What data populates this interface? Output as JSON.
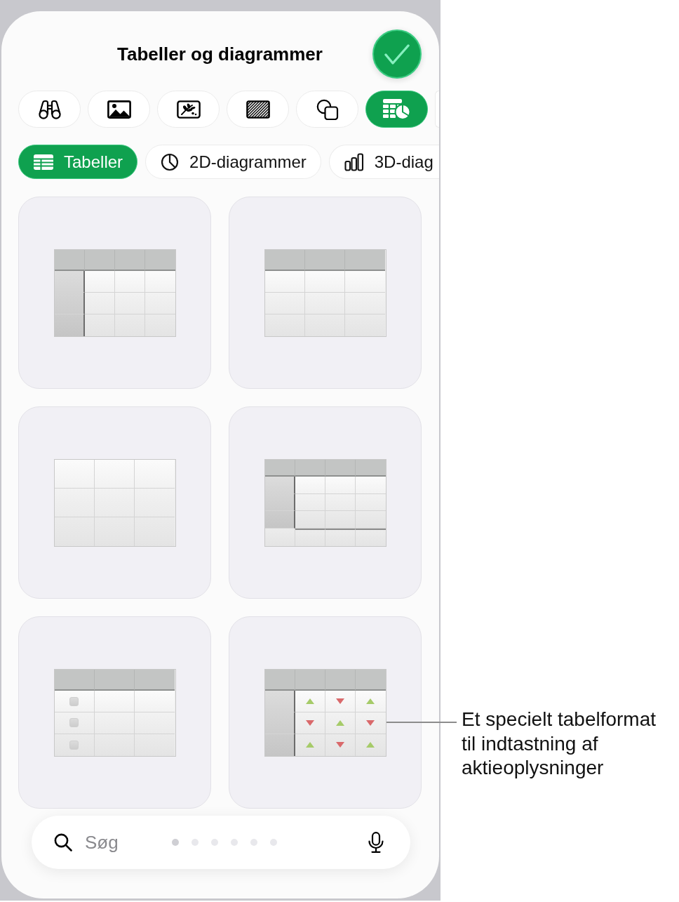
{
  "title": "Tabeller og diagrammer",
  "categories": [
    {
      "selected": false
    },
    {
      "selected": false
    },
    {
      "selected": false
    },
    {
      "selected": false
    },
    {
      "selected": false
    },
    {
      "selected": true
    },
    {
      "selected": false
    }
  ],
  "segments": [
    {
      "label": "Tabeller",
      "selected": true
    },
    {
      "label": "2D-diagrammer",
      "selected": false
    },
    {
      "label": "3D-diag",
      "selected": false
    }
  ],
  "table_styles": [
    {
      "kind": "headers"
    },
    {
      "kind": "header-row"
    },
    {
      "kind": "plain"
    },
    {
      "kind": "headers-footer"
    },
    {
      "kind": "checklist"
    },
    {
      "kind": "stocks"
    }
  ],
  "search": {
    "placeholder": "Søg"
  },
  "page_dots": [
    {
      "selected": true
    },
    {
      "selected": false
    },
    {
      "selected": false
    },
    {
      "selected": false
    },
    {
      "selected": false
    },
    {
      "selected": false
    }
  ],
  "callout": {
    "text": "Et specielt tabelformat til indtastning af aktieoplysninger"
  }
}
